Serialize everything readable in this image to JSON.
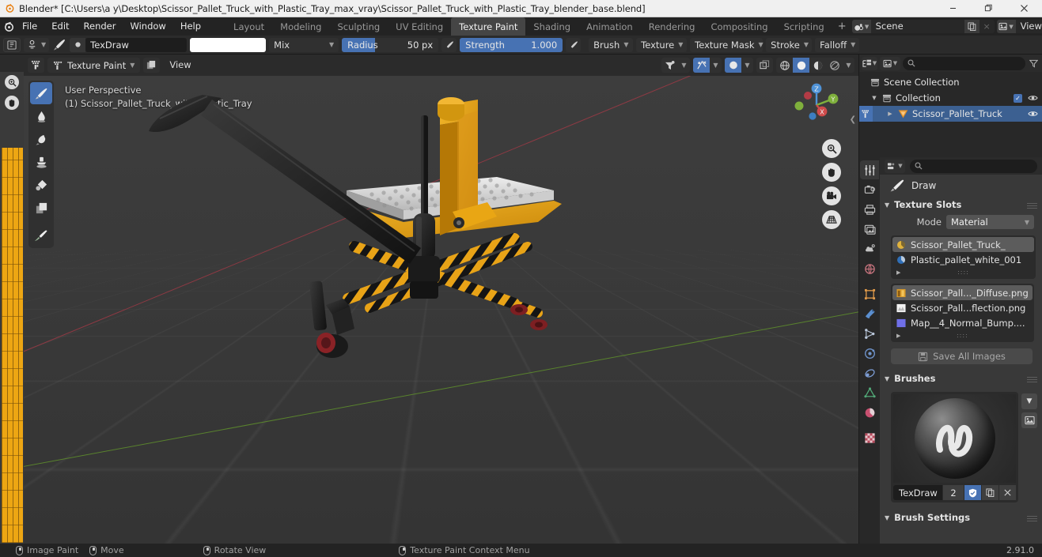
{
  "window": {
    "title": "Blender* [C:\\Users\\a y\\Desktop\\Scissor_Pallet_Truck_with_Plastic_Tray_max_vray\\Scissor_Pallet_Truck_with_Plastic_Tray_blender_base.blend]",
    "minimize": "–",
    "maximize": "❐",
    "close": "×"
  },
  "menus": [
    "File",
    "Edit",
    "Render",
    "Window",
    "Help"
  ],
  "workspace_tabs": [
    {
      "label": "Layout",
      "active": false
    },
    {
      "label": "Modeling",
      "active": false
    },
    {
      "label": "Sculpting",
      "active": false
    },
    {
      "label": "UV Editing",
      "active": false
    },
    {
      "label": "Texture Paint",
      "active": true
    },
    {
      "label": "Shading",
      "active": false
    },
    {
      "label": "Animation",
      "active": false
    },
    {
      "label": "Rendering",
      "active": false
    },
    {
      "label": "Compositing",
      "active": false
    },
    {
      "label": "Scripting",
      "active": false
    }
  ],
  "workspace_add": "+",
  "topbar_right": {
    "scene_name": "Scene",
    "view_layer_name": "View Layer",
    "new_copy": "⧉",
    "remove": "×"
  },
  "tool_settings": {
    "brush_name": "TexDraw",
    "color_hex": "#ffffff",
    "blend_mode": "Mix",
    "radius_label": "Radius",
    "radius_value": "50 px",
    "radius_fill_pct": 34,
    "strength_label": "Strength",
    "strength_value": "1.000",
    "strength_fill_pct": 100,
    "popovers": [
      "Brush",
      "Texture",
      "Texture Mask",
      "Stroke",
      "Falloff"
    ]
  },
  "viewport_header": {
    "mode": "Texture Paint",
    "view_menu": "View"
  },
  "viewport": {
    "perspective_label": "User Perspective",
    "object_label": "(1) Scissor_Pallet_Truck_with_Plastic_Tray",
    "gizmo_axes": [
      "X",
      "Y",
      "Z"
    ],
    "colors": {
      "background": "#393939",
      "axis_x": "#9c3a45",
      "axis_y": "#5d8c2c",
      "model_yellow": "#e8a317",
      "model_dark": "#1c1c1c",
      "model_tray": "#d8d8d8"
    },
    "tools": [
      {
        "name": "draw-tool",
        "active": true
      },
      {
        "name": "soften-tool",
        "active": false
      },
      {
        "name": "smear-tool",
        "active": false
      },
      {
        "name": "clone-tool",
        "active": false
      },
      {
        "name": "fill-tool",
        "active": false
      },
      {
        "name": "mask-tool",
        "active": false
      },
      {
        "name": "annotate-tool",
        "active": false
      }
    ]
  },
  "outliner": {
    "search_placeholder": "",
    "rows": [
      {
        "label": "Scene Collection",
        "indent": 0,
        "icon": "collection-icon",
        "disclosure": false,
        "checkbox": false,
        "eye": false,
        "selected": false
      },
      {
        "label": "Collection",
        "indent": 1,
        "icon": "collection-icon",
        "disclosure": true,
        "checkbox": true,
        "eye": true,
        "selected": false
      },
      {
        "label": "Scissor_Pallet_Truck",
        "indent": 2,
        "icon": "mesh-icon",
        "disclosure": true,
        "checkbox": false,
        "eye": true,
        "selected": true
      }
    ]
  },
  "properties": {
    "search_placeholder": "",
    "active_tool_label": "Draw",
    "tabs": [
      {
        "name": "tool-tab",
        "active": true
      },
      {
        "name": "render-tab",
        "active": false
      },
      {
        "name": "output-tab",
        "active": false
      },
      {
        "name": "view-layer-tab",
        "active": false
      },
      {
        "name": "scene-tab",
        "active": false
      },
      {
        "name": "world-tab",
        "active": false
      },
      {
        "name": "object-tab",
        "active": false
      },
      {
        "name": "modifier-tab",
        "active": false
      },
      {
        "name": "particles-tab",
        "active": false
      },
      {
        "name": "physics-tab",
        "active": false
      },
      {
        "name": "constraints-tab",
        "active": false
      },
      {
        "name": "object-data-tab",
        "active": false
      },
      {
        "name": "material-tab",
        "active": false
      },
      {
        "name": "texture-tab",
        "active": false
      }
    ],
    "texture_slots": {
      "title": "Texture Slots",
      "mode_label": "Mode",
      "mode_value": "Material",
      "materials": [
        {
          "label": "Scissor_Pallet_Truck_",
          "selected": true
        },
        {
          "label": "Plastic_pallet_white_001",
          "selected": false
        }
      ],
      "images": [
        {
          "label": "Scissor_Pall..._Diffuse.png",
          "selected": true
        },
        {
          "label": "Scissor_Pall...flection.png",
          "selected": false
        },
        {
          "label": "Map__4_Normal_Bump....",
          "selected": false
        }
      ],
      "add_button": "+",
      "save_all_label": "Save All Images"
    },
    "brushes": {
      "title": "Brushes",
      "brush_name": "TexDraw",
      "users_count": "2",
      "fake_user_icon": "shield-icon",
      "duplicate_icon": "copy-icon",
      "unlink_icon": "x-icon"
    },
    "brush_settings": {
      "title": "Brush Settings"
    }
  },
  "statusbar": {
    "items": [
      {
        "label": "Image Paint",
        "mouse": "left"
      },
      {
        "label": "Move",
        "mouse": "left-drag"
      },
      {
        "label": "Rotate View",
        "mouse": "middle"
      },
      {
        "label": "Texture Paint Context Menu",
        "mouse": "right"
      }
    ],
    "version": "2.91.0"
  }
}
